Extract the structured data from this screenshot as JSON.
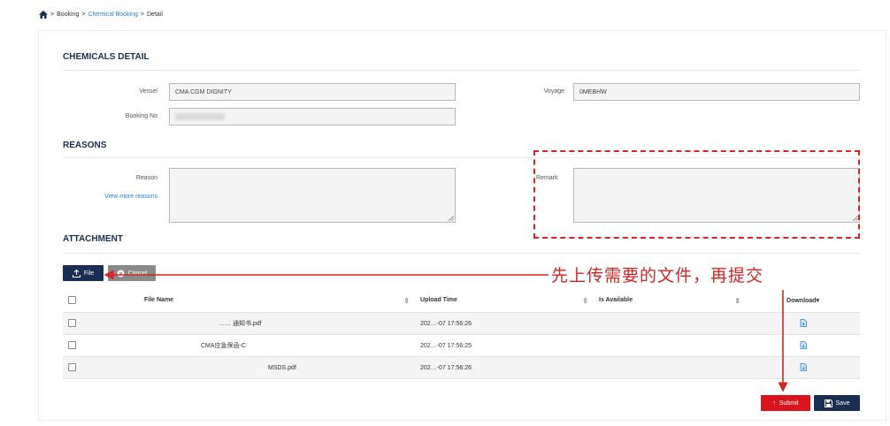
{
  "breadcrumb": {
    "home_icon": "home-icon",
    "sep": ">",
    "items": [
      "Booking",
      "Chemical Booking",
      "Detail"
    ]
  },
  "chemicals_detail": {
    "title": "CHEMICALS DETAIL",
    "vessel_label": "Vessel",
    "vessel_value": "CMA CGM DIGNITY",
    "voyage_label": "Voyage",
    "voyage_value": "0MEBHW",
    "booking_label": "Booking No",
    "booking_value": ""
  },
  "reasons": {
    "title": "REASONS",
    "reason_label": "Reason",
    "view_more": "View more reasons",
    "remark_label": "Remark"
  },
  "attachment": {
    "title": "ATTACHMENT",
    "file_button": "File",
    "cancel_button": "Cancel",
    "columns": {
      "file_name": "File Name",
      "upload_time": "Upload Time",
      "is_available": "Is Available",
      "download": "Download"
    },
    "rows": [
      {
        "file_name": "…… 通知书.pdf",
        "upload_time": "202…-07 17:56:26",
        "is_available": ""
      },
      {
        "file_name": "CMA应急保函-C",
        "upload_time": "202…-07 17:56:25",
        "is_available": ""
      },
      {
        "file_name": "MSDS.pdf",
        "upload_time": "202…-07 17:56:26",
        "is_available": ""
      }
    ]
  },
  "actions": {
    "submit": "Submit",
    "save": "Save"
  },
  "annotation": {
    "text": "先上传需要的文件，再提交",
    "color": "#d62424"
  }
}
